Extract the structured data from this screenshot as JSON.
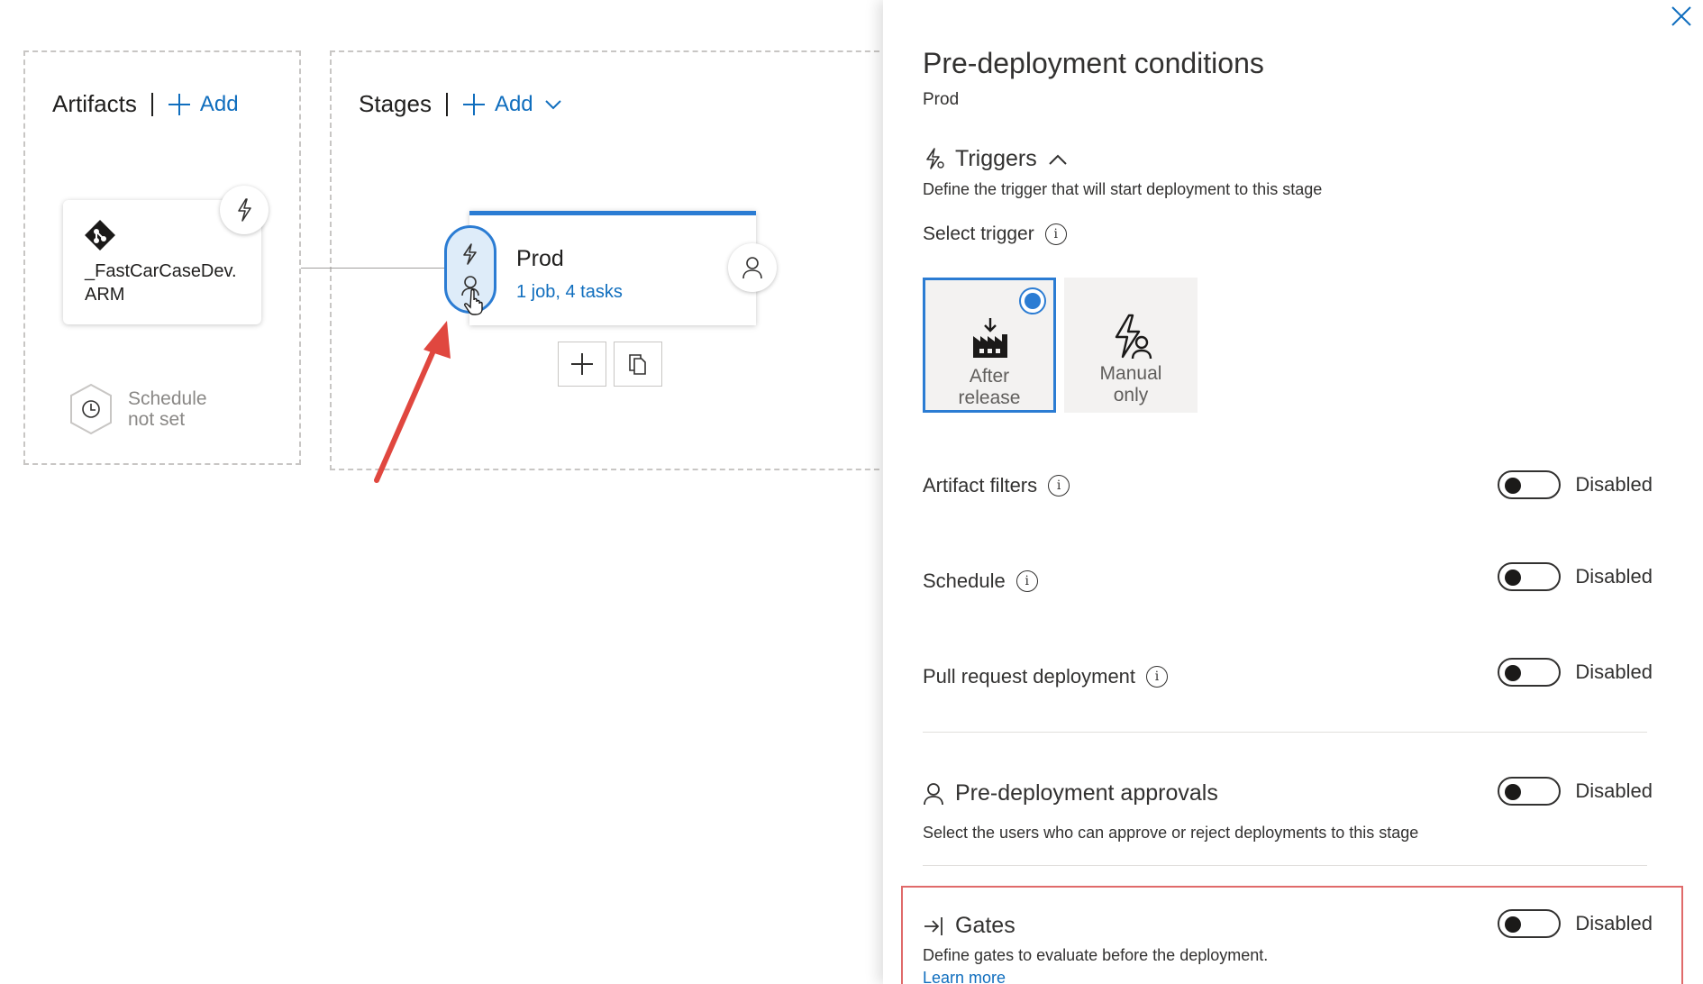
{
  "pipeline": {
    "artifacts_heading": "Artifacts",
    "artifacts_add": "Add",
    "stages_heading": "Stages",
    "stages_add": "Add",
    "artifact_name": "_FastCarCaseDev.ARM",
    "schedule_text": "Schedule not set",
    "stage_name": "Prod",
    "stage_summary": "1 job, 4 tasks"
  },
  "panel": {
    "title": "Pre-deployment conditions",
    "subtitle": "Prod",
    "triggers": {
      "heading": "Triggers",
      "description": "Define the trigger that will start deployment to this stage",
      "select_label": "Select trigger",
      "options": [
        {
          "label": "After release",
          "selected": true
        },
        {
          "label": "Manual only",
          "selected": false
        }
      ]
    },
    "rows": {
      "artifact_filters": {
        "label": "Artifact filters",
        "state": "Disabled"
      },
      "schedule": {
        "label": "Schedule",
        "state": "Disabled"
      },
      "pull_request": {
        "label": "Pull request deployment",
        "state": "Disabled"
      }
    },
    "approvals": {
      "heading": "Pre-deployment approvals",
      "description": "Select the users who can approve or reject deployments to this stage",
      "state": "Disabled"
    },
    "gates": {
      "heading": "Gates",
      "description": "Define gates to evaluate before the deployment.",
      "link": "Learn more",
      "state": "Disabled"
    }
  },
  "colors": {
    "accent": "#2b7cd3",
    "link": "#106ebe",
    "annotation_arrow": "#e0473f",
    "highlight_box": "#e06a6a"
  }
}
